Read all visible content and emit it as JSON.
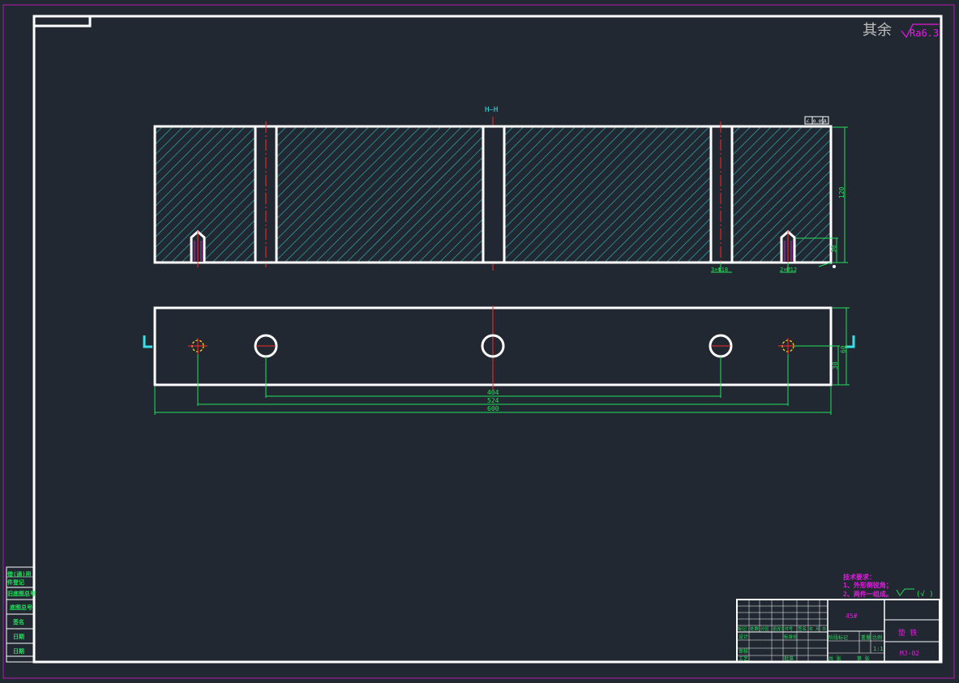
{
  "roughness": {
    "label": "其余",
    "value": "Ra6.3"
  },
  "section_label": "H—H",
  "tolerance_frame": {
    "symbol": "∠",
    "value": "0.05",
    "datum": "A"
  },
  "dimensions": {
    "height_top": "120",
    "height_small": "30",
    "holes_a": "3×Φ18",
    "holes_b": "2×M12",
    "height_bottom": "60",
    "offset_bottom": "30",
    "span_404": "404",
    "span_524": "524",
    "span_600": "600"
  },
  "notes": {
    "title": "技术要求：",
    "line1": "1、外形倒锐角；",
    "line2": "2、两件一组成。",
    "side_roughness": "(√ )"
  },
  "title_block": {
    "material": "45#",
    "part_name": "垫  铁",
    "drawing_no": "MJ-02",
    "scale": "1:1",
    "row_labels": [
      "标记",
      "处数",
      "分区",
      "更改文件号",
      "签名",
      "年 月 日"
    ],
    "cells": [
      "设计",
      "标准化",
      "审核",
      "工艺",
      "批准",
      "阶段标记",
      "重量",
      "比例",
      "共 张",
      "第 张"
    ]
  },
  "left_stamp": [
    "借(通)用",
    "件登记",
    "旧底图总号",
    "底图总号",
    "签名",
    "日期",
    "日期"
  ],
  "colors": {
    "background": "#222831",
    "outline": "#ffffff",
    "hatch": "#2ab5bd",
    "centerline": "#ff2a2a",
    "dimension": "#21e05a",
    "text_green": "#21e05a",
    "text_magenta": "#e01ce0",
    "frame_magenta": "#b01ab0",
    "cyan": "#36e0e8"
  }
}
